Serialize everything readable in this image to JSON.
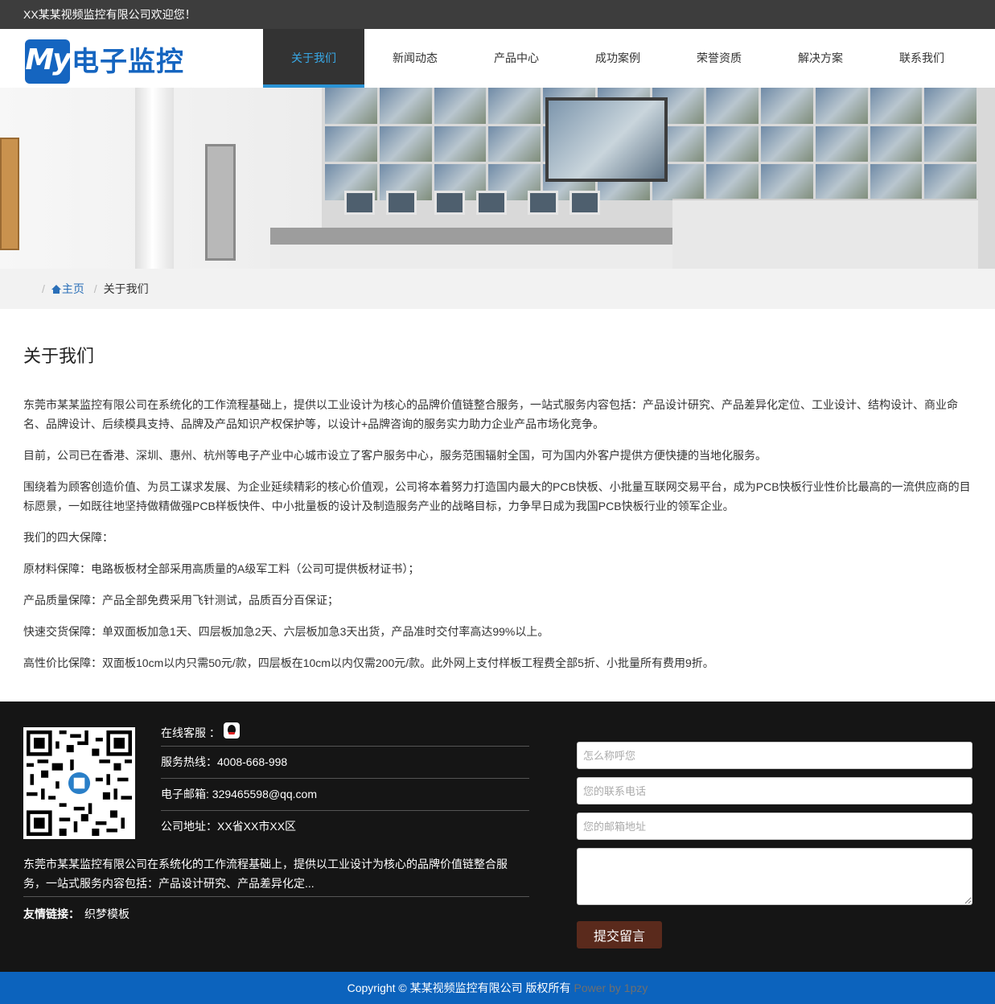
{
  "topbar": {
    "welcome": "XX某某视频监控有限公司欢迎您！"
  },
  "logo": {
    "badge": "My",
    "text": "电子监控"
  },
  "nav": {
    "items": [
      "关于我们",
      "新闻动态",
      "产品中心",
      "成功案例",
      "荣誉资质",
      "解决方案",
      "联系我们"
    ],
    "active": "关于我们"
  },
  "breadcrumb": {
    "home": "主页",
    "current": "关于我们"
  },
  "main": {
    "title": "关于我们",
    "paragraphs": [
      "东莞市某某监控有限公司在系统化的工作流程基础上，提供以工业设计为核心的品牌价值链整合服务，一站式服务内容包括：产品设计研究、产品差异化定位、工业设计、结构设计、商业命名、品牌设计、后续模具支持、品牌及产品知识产权保护等，以设计+品牌咨询的服务实力助力企业产品市场化竞争。",
      "目前，公司已在香港、深圳、惠州、杭州等电子产业中心城市设立了客户服务中心，服务范围辐射全国，可为国内外客户提供方便快捷的当地化服务。",
      "围绕着为顾客创造价值、为员工谋求发展、为企业延续精彩的核心价值观，公司将本着努力打造国内最大的PCB快板、小批量互联网交易平台，成为PCB快板行业性价比最高的一流供应商的目标愿景，一如既往地坚持做精做强PCB样板快件、中小批量板的设计及制造服务产业的战略目标，力争早日成为我国PCB快板行业的领军企业。",
      "我们的四大保障：",
      "原材料保障：电路板板材全部采用高质量的A级军工料（公司可提供板材证书）；",
      "产品质量保障：产品全部免费采用飞针测试，品质百分百保证；",
      "快速交货保障：单双面板加急1天、四层板加急2天、六层板加急3天出货，产品准时交付率高达99%以上。",
      "高性价比保障：双面板10cm以内只需50元/款，四层板在10cm以内仅需200元/款。此外网上支付样板工程费全部5折、小批量所有费用9折。"
    ]
  },
  "footer": {
    "online_service": "在线客服 ：",
    "hotline": "服务热线：4008-668-998",
    "email": "电子邮箱: 329465598@qq.com",
    "address": "公司地址：XX省XX市XX区",
    "about": "东莞市某某监控有限公司在系统化的工作流程基础上，提供以工业设计为核心的品牌价值链整合服务，一站式服务内容包括：产品设计研究、产品差异化定...",
    "links_label": "友情链接：",
    "link_1": "织梦模板",
    "form": {
      "name_placeholder": "怎么称呼您",
      "phone_placeholder": "您的联系电话",
      "email_placeholder": "您的邮箱地址",
      "message_placeholder": "",
      "submit_label": "提交留言"
    }
  },
  "copyright": {
    "text": "Copyright © 某某视频监控有限公司 版权所有",
    "power": "Power by 1pzy"
  },
  "colors": {
    "topbar": "#3d3d3d",
    "accent": "#2a93d5",
    "footer": "#151515",
    "copyright_bar": "#0c63bd",
    "submit": "#5a2a1c"
  }
}
